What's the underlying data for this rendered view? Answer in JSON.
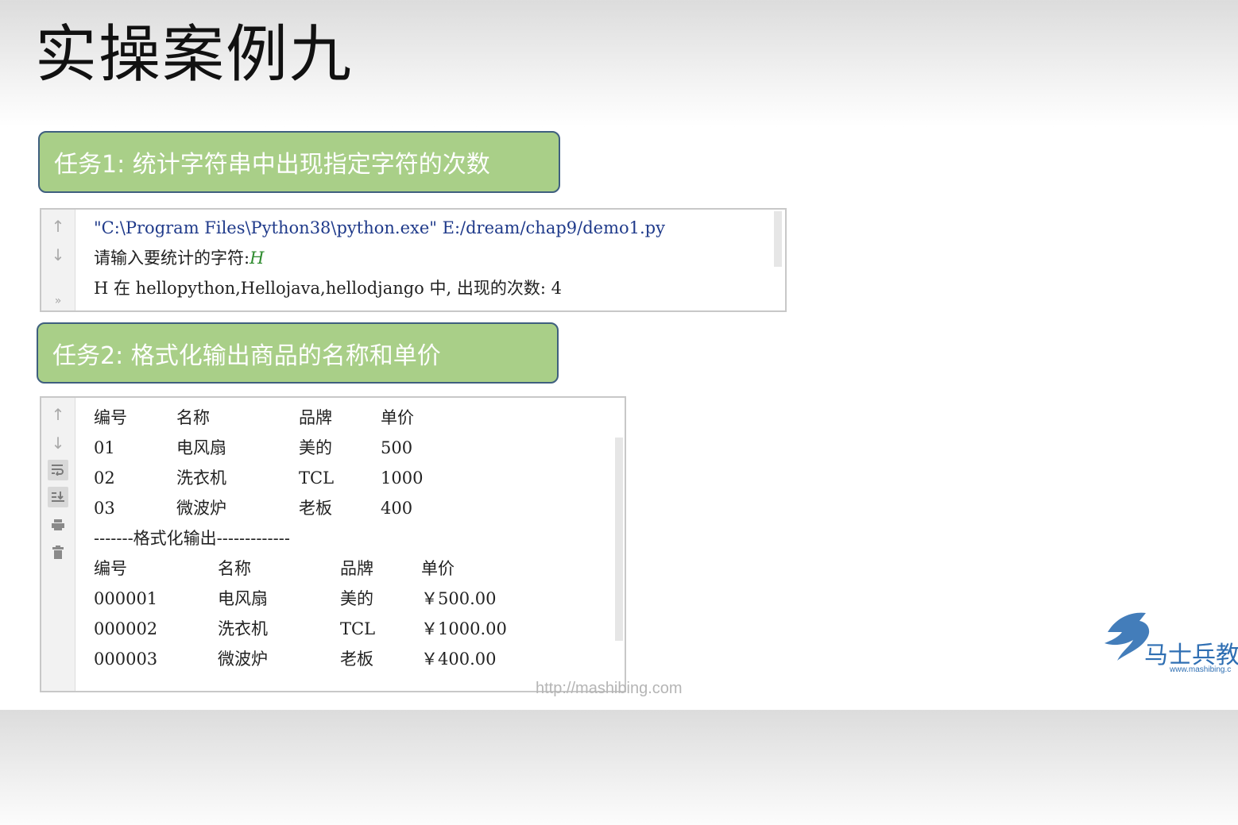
{
  "slide": {
    "title": "实操案例九",
    "footer_url": "http://mashibing.com"
  },
  "task1": {
    "label": "任务1:  统计字符串中出现指定字符的次数",
    "console": {
      "cmd_path": "\"C:\\Program Files\\Python38\\python.exe\" E:/dream/chap9/demo1.py",
      "prompt": "请输入要统计的字符:",
      "input": "H",
      "result": "H 在 hellopython,Hellojava,hellodjango 中, 出现的次数: 4"
    }
  },
  "task2": {
    "label": "任务2:  格式化输出商品的名称和单价",
    "console": {
      "table1": {
        "headers": [
          "编号",
          "名称",
          "品牌",
          "单价"
        ],
        "rows": [
          [
            "01",
            "电风扇",
            "美的",
            "500"
          ],
          [
            "02",
            "洗衣机",
            "TCL",
            "1000"
          ],
          [
            "03",
            "微波炉",
            "老板",
            "400"
          ]
        ]
      },
      "separator": "-------格式化输出-------------",
      "table2": {
        "headers": [
          "编号",
          "名称",
          "品牌",
          "单价"
        ],
        "rows": [
          [
            "000001",
            "电风扇",
            "美的",
            "￥500.00"
          ],
          [
            "000002",
            "洗衣机",
            "TCL",
            "￥1000.00"
          ],
          [
            "000003",
            "微波炉",
            "老板",
            "￥400.00"
          ]
        ]
      }
    }
  },
  "logo": {
    "name": "马士兵教",
    "url": "www.mashibing.c"
  },
  "colors": {
    "task_box_bg": "#a9cf88",
    "task_box_border": "#3f5f7f",
    "path_text": "#1f3a8a",
    "input_text": "#2e8b2e",
    "logo_blue": "#2f6fb3"
  },
  "icons": {
    "scroll_up": "arrow-up-icon",
    "scroll_down": "arrow-down-icon",
    "more": "double-chevron-icon",
    "soft_wrap": "soft-wrap-icon",
    "scroll_to_end": "scroll-to-end-icon",
    "print": "print-icon",
    "clear": "trash-icon"
  }
}
